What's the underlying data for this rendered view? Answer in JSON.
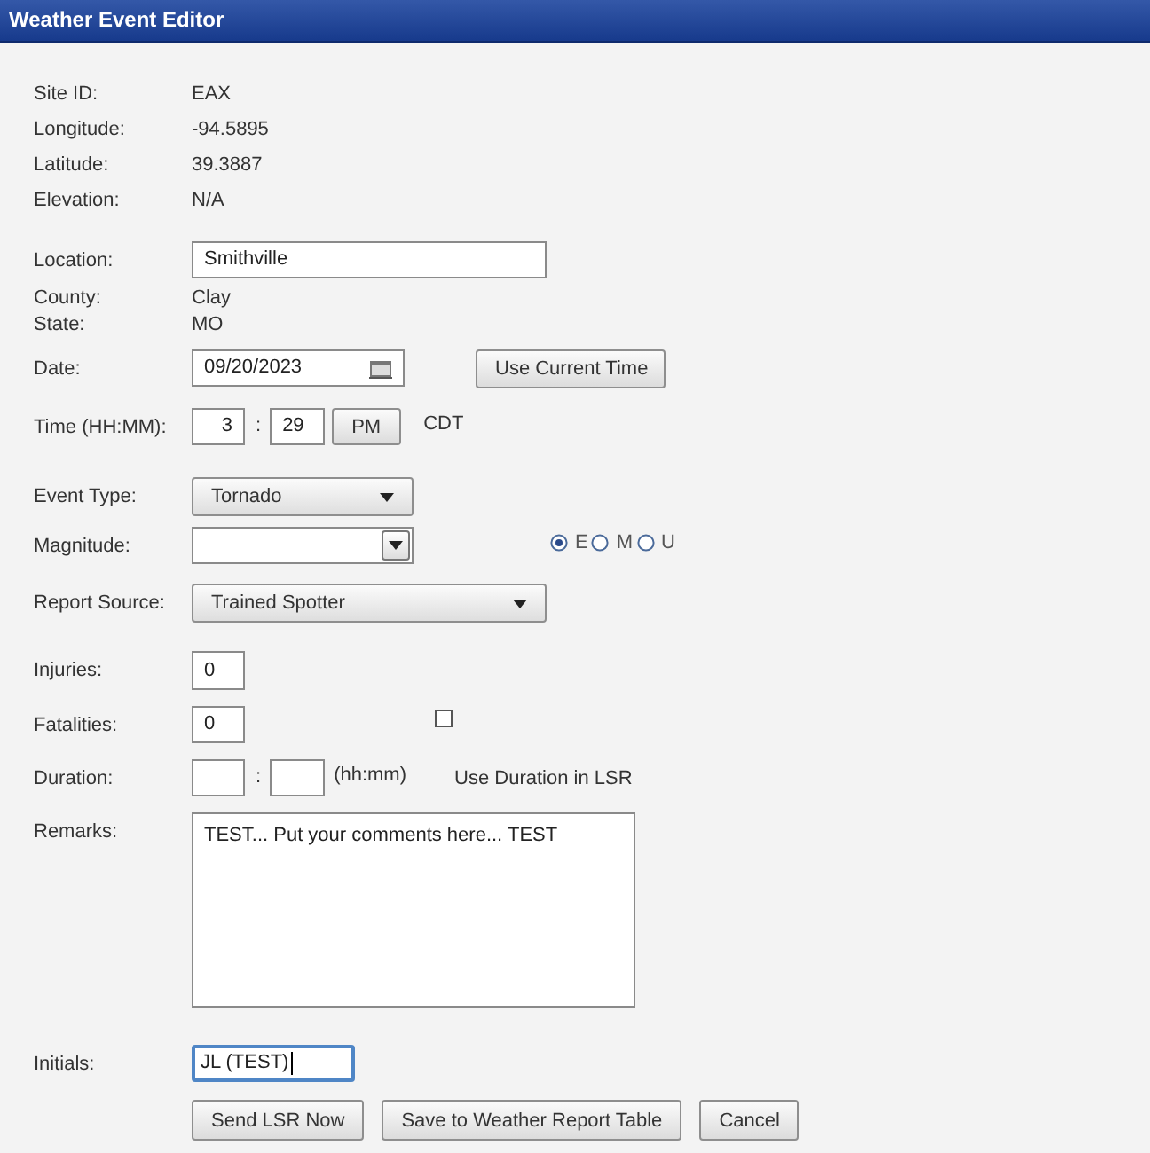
{
  "window": {
    "title": "Weather Event Editor"
  },
  "site_info": [
    {
      "label": "Site ID:",
      "value": "EAX"
    },
    {
      "label": "Longitude:",
      "value": "-94.5895"
    },
    {
      "label": "Latitude:",
      "value": "39.3887"
    },
    {
      "label": "Elevation:",
      "value": "N/A"
    }
  ],
  "location": {
    "label": "Location:",
    "value": "Smithville"
  },
  "county": {
    "label": "County:",
    "value": "Clay"
  },
  "state": {
    "label": "State:",
    "value": "MO"
  },
  "date": {
    "label": "Date:",
    "value": "09/20/2023",
    "button": "Use Current Time"
  },
  "time": {
    "label": "Time (HH:MM):",
    "hour": "3",
    "separator": ":",
    "minute": "29",
    "ampm": "PM",
    "zone": "CDT"
  },
  "event_type": {
    "label": "Event Type:",
    "value": "Tornado"
  },
  "magnitude": {
    "label": "Magnitude:",
    "options": [
      {
        "label": "E",
        "selected": true
      },
      {
        "label": "M",
        "selected": false
      },
      {
        "label": "U",
        "selected": false
      }
    ]
  },
  "report_source": {
    "label": "Report Source:",
    "value": "Trained Spotter"
  },
  "injuries": {
    "label": "Injuries:",
    "value": "0"
  },
  "fatalities": {
    "label": "Fatalities:",
    "value": "0"
  },
  "use_duration_in_lsr": {
    "label": "Use Duration in LSR",
    "checked": false
  },
  "duration": {
    "label": "Duration:",
    "separator": ":",
    "hint": "(hh:mm)"
  },
  "remarks": {
    "label": "Remarks:",
    "value": "TEST... Put your comments here... TEST"
  },
  "initials": {
    "label": "Initials:",
    "value": "JL (TEST)",
    "focused": true
  },
  "buttons": [
    "Send LSR Now",
    "Save to Weather Report Table",
    "Cancel"
  ]
}
